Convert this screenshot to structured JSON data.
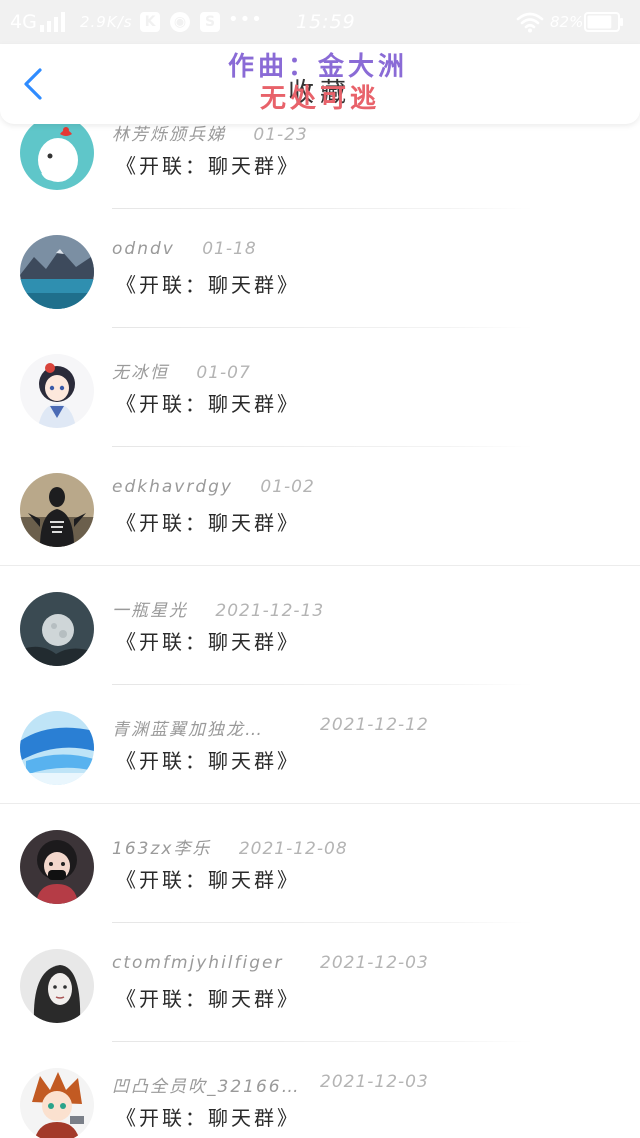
{
  "status_bar": {
    "network": "4G",
    "speed": "2.9K/s",
    "app_k_label": "K",
    "app_s_label": "S",
    "more": "•••",
    "time": "15:59",
    "battery_percent": "82%",
    "battery_level": 0.82
  },
  "header": {
    "title": "收藏",
    "overlay_line1": "作曲：金大洲",
    "overlay_line2": "无处可逃"
  },
  "items": [
    {
      "username": "林芳烁颁兵娣",
      "date": "01-23",
      "message": "《开联：聊天群》",
      "avatar": "avatar-elephant"
    },
    {
      "username": "odndv",
      "date": "01-18",
      "message": "《开联：聊天群》",
      "avatar": "avatar-mountain-lake"
    },
    {
      "username": "无冰恒",
      "date": "01-07",
      "message": "《开联：聊天群》",
      "avatar": "avatar-anime-girl"
    },
    {
      "username": "edkhavrdgy",
      "date": "01-02",
      "message": "《开联：聊天群》",
      "avatar": "avatar-hoodie-person"
    },
    {
      "username": "一瓶星光",
      "date": "2021-12-13",
      "message": "《开联：聊天群》",
      "avatar": "avatar-moon"
    },
    {
      "username": "青渊蓝翼加独龙…",
      "date": "2021-12-12",
      "message": "《开联：聊天群》",
      "avatar": "avatar-blue-wings"
    },
    {
      "username": "163zx李乐",
      "date": "2021-12-08",
      "message": "《开联：聊天群》",
      "avatar": "avatar-masked-girl"
    },
    {
      "username": "ctomfmjyhilfiger",
      "date": "2021-12-03",
      "message": "《开联：聊天群》",
      "avatar": "avatar-woman-portrait"
    },
    {
      "username": "凹凸全员吹_32166…",
      "date": "2021-12-03",
      "message": "《开联：聊天群》",
      "avatar": "avatar-anime-boy"
    }
  ]
}
